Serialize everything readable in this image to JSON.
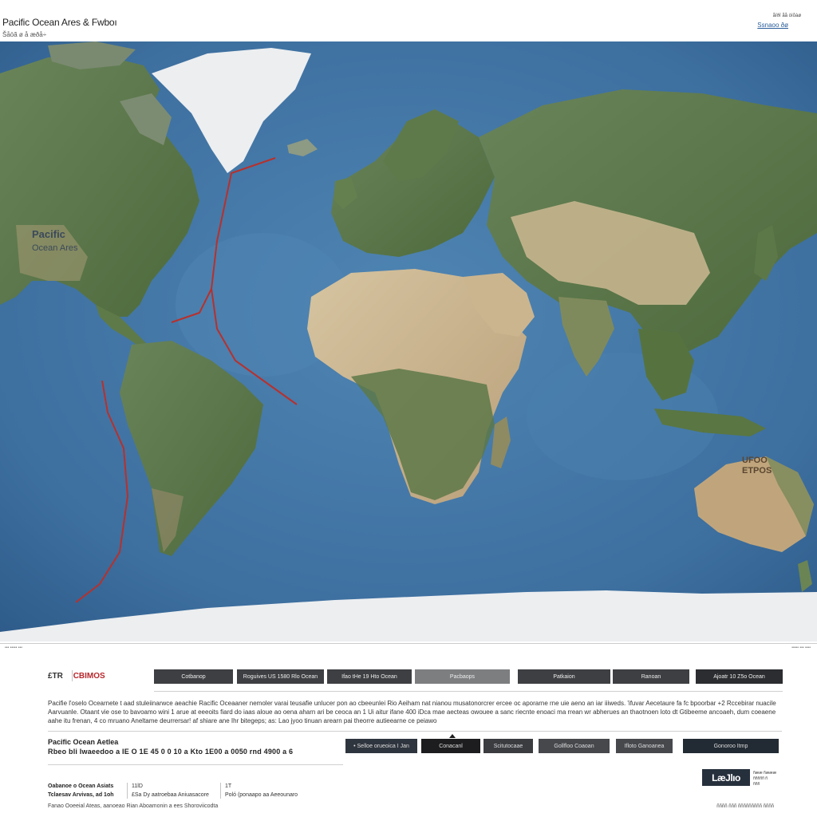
{
  "header": {
    "title": "Pacific Ocean Ares & Fwboı",
    "subtitle": "Šåöã ø å æðå÷",
    "top_right_small": "åîðî åå òìõàø",
    "top_right_link": "Ssnaoo ðø"
  },
  "map": {
    "labels": {
      "pacific": "Pacific",
      "ocean": "Ocean Ares",
      "australia_1": "UFOO",
      "australia_2": "ETPOS"
    },
    "colors": {
      "ocean": "#4a7fad",
      "ocean_deep": "#2f5f8e",
      "land_green": "#5d7848",
      "land_desert": "#c9b48f",
      "ice": "#ecedef",
      "route": "#b8302c"
    },
    "footnote_left": "••• ••••• •••",
    "footnote_right": "••••• ••• ••••"
  },
  "toolbar": {
    "logo_prefix": "£TR",
    "logo_main": "CBIMOS",
    "buttons": [
      "Cotbanop",
      "Roguives US 1580 Rlo Ocean",
      "Ifao tHe 19 Hto Ocean",
      "Pacbaops",
      "Patkaion",
      "Ranoan",
      "Ajoatr 10 Z5o Ocean"
    ]
  },
  "description": "Pacifie l'oselo Ocearnete t aad stuleiinarwce aeachie Racific Oceaaner nemoler varai teusafie unlucer pon ao cbeeunlei Rio Aeiham nat nianou musatonorcrer ercee oc aporarne rne uie aeno an iar iiiweds. 'ifuvar Aecetaure fa fc bpoorbar +2 Rccebirar nuacile Aarvuanle. Otaant vie ose to bavoamo wini 1 arue at eeeoits fiard do iaas aloue ao oena aharn ari be ceoca an 1 Ui aitur ifane 400 iDca mae aecteas owouee a sanc riecnte enoaci ma rrean wr abherues an thaotnoen loto dt Gtibeeme ancoaeh, dum coeaene aahe itu frenan, 4 co mruano Aneltame deurrersar! af shiare ane Ihr bitegeps; as: Lao jyoo tinuan arearn pai theorre autieearne ce peiawo",
  "area": {
    "title": "Pacific Ocean Aetlea",
    "values": "Rbeo bli Iwaeedoo a IE O 1E 45 0 0 10 a Kto 1E00 a 0050 rnd 4900 a 6"
  },
  "actions": {
    "buttons": [
      "• Selloe orueoica I Jan",
      "Conacanl",
      "Scitutocaae",
      "Gollfloo Coaoan",
      "Ifloto Ganoanea",
      "Gonoroo Itmp"
    ]
  },
  "footer": {
    "left_1": "Oabanoe o Ocean Asiats",
    "left_2": "Tclaesav Arvivas, ad 1oh",
    "mid_1": "11lD",
    "mid_2": "£Sa Dy aatroebaa Aniuasacore",
    "r_1": "1T",
    "r_2": "Poló (ponaapo aa Aeeounaro",
    "bottom": "Fanao Ooeeial Ateas, aanoeao Rian Aboamonin a ees Shoroviicodta",
    "brand": "LæJlıo",
    "brand_side_1": "ñææ ñæææ",
    "brand_side_2": "ñññññ ñ",
    "brand_side_3": "ñññ",
    "right": "ññññ ñññ ñññññññññ ññññ"
  }
}
